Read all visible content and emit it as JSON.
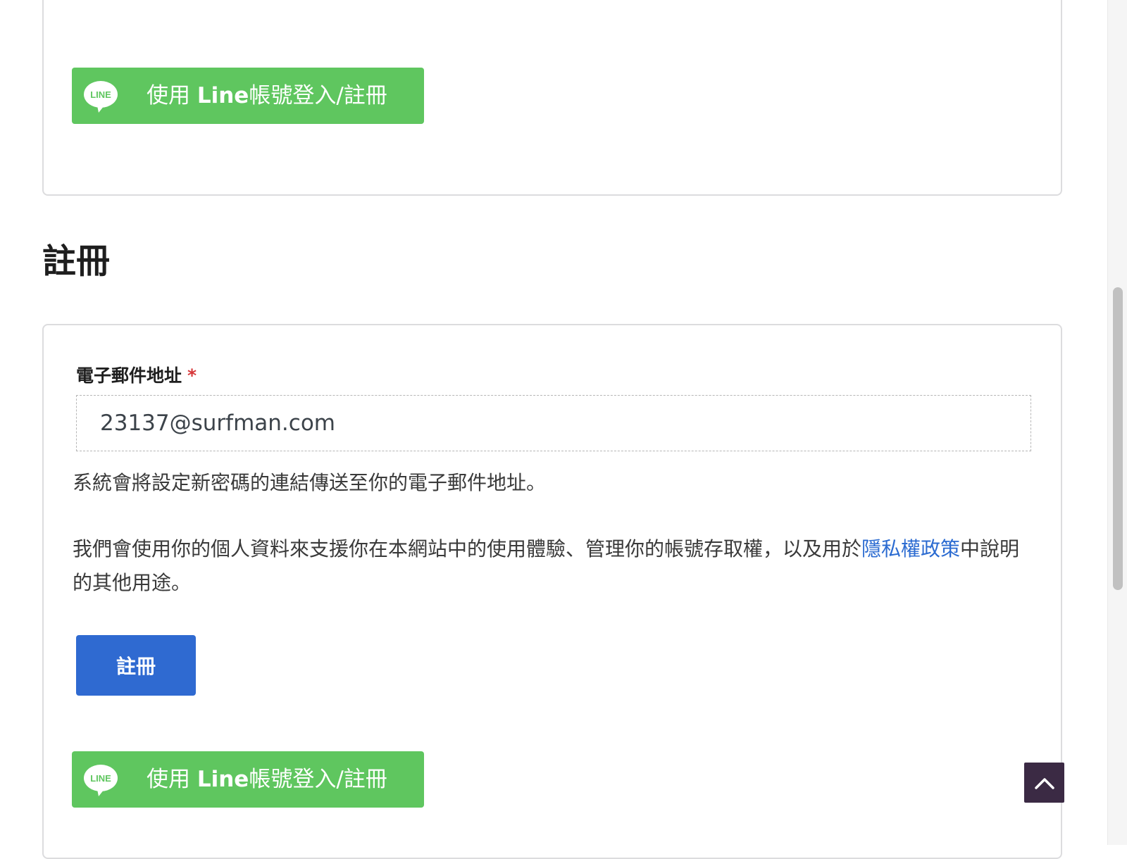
{
  "line_login": {
    "logo_text": "LINE",
    "label_prefix": "使用 ",
    "label_brand": "Line",
    "label_suffix": "帳號登入/註冊"
  },
  "register": {
    "heading": "註冊",
    "email_label": "電子郵件地址",
    "required_mark": "*",
    "email_value": "23137@surfman.com",
    "password_info": "系統會將設定新密碼的連結傳送至你的電子郵件地址。",
    "privacy_before": "我們會使用你的個人資料來支援你在本網站中的使用體驗、管理你的帳號存取權，以及用於",
    "privacy_link": "隱私權政策",
    "privacy_after": "中說明的其他用途。",
    "submit_label": "註冊"
  },
  "icons": {
    "line_logo": "line-logo-icon",
    "scroll_top": "chevron-up-icon"
  },
  "colors": {
    "line_green": "#5fc65f",
    "primary_blue": "#2f6ad1",
    "link_blue": "#2b6bd1",
    "required_red": "#d63638",
    "scroll_top_bg": "#3b2a44"
  }
}
